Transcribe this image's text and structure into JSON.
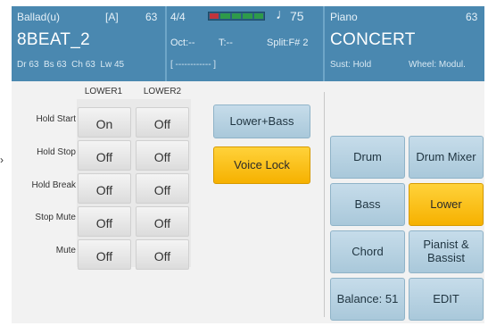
{
  "header": {
    "style_panel": {
      "style_name": "Ballad(u)",
      "bank": "[A]",
      "number": "63",
      "main_name": "8BEAT_2",
      "volumes": "Dr 63  Bs 63  Ch 63  Lw 45"
    },
    "tempo_panel": {
      "time_signature": "4/4",
      "note_glyph": "♩",
      "tempo": "75",
      "octave": "Oct:--",
      "transpose": "T:--",
      "split": "Split:F# 2",
      "measure": "[ ------------ ]",
      "level_colors": [
        "#c0343c",
        "#2e9a4a",
        "#2e9a4a",
        "#2e9a4a",
        "#2e9a4a"
      ]
    },
    "voice_panel": {
      "voice_category": "Piano",
      "number": "63",
      "main_name": "CONCERT",
      "sustain": "Sust: Hold",
      "wheel": "Wheel: Modul."
    }
  },
  "left_grid": {
    "columns": [
      "LOWER1",
      "LOWER2"
    ],
    "rows": [
      {
        "label": "Hold Start",
        "values": [
          "On",
          "Off"
        ]
      },
      {
        "label": "Hold Stop",
        "values": [
          "Off",
          "Off"
        ]
      },
      {
        "label": "Hold Break",
        "values": [
          "Off",
          "Off"
        ]
      },
      {
        "label": "Stop Mute",
        "values": [
          "Off",
          "Off"
        ]
      },
      {
        "label": "Mute",
        "values": [
          "Off",
          "Off"
        ]
      }
    ]
  },
  "middle": {
    "lower_bass": "Lower+Bass",
    "voice_lock": "Voice Lock"
  },
  "right_buttons": {
    "drum": "Drum",
    "drum_mixer": "Drum Mixer",
    "bass": "Bass",
    "lower": "Lower",
    "chord": "Chord",
    "pianist_bassist": "Pianist & Bassist",
    "balance": "Balance: 51",
    "edit": "EDIT"
  },
  "colors": {
    "header_blue": "#4a88b0",
    "button_blue": "#b7d1e1",
    "active_orange": "#f9be14"
  },
  "edge_arrow_glyph": "›"
}
